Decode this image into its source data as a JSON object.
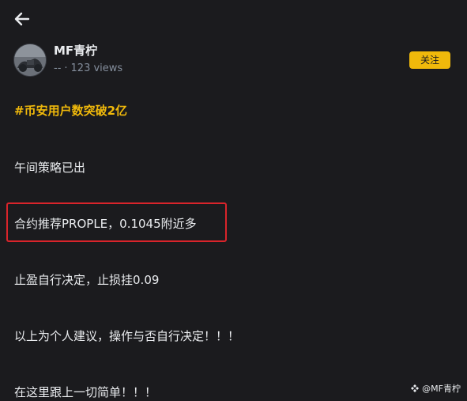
{
  "author": {
    "name": "MF青柠",
    "date": "--",
    "views": "123 views"
  },
  "follow_label": "关注",
  "post": {
    "hashtag": "#币安用户数突破2亿",
    "line1": "午间策略已出",
    "line2": "合约推荐PROPLE，0.1045附近多",
    "line3": "止盈自行决定，止损挂0.09",
    "line4": "以上为个人建议，操作与否自行决定！！！",
    "line5": "在这里跟上一切简单！！！"
  },
  "watermark": "@MF青柠",
  "colors": {
    "accent": "#f0b90b",
    "highlight_border": "#d9242b",
    "background": "#1b1b1e"
  }
}
